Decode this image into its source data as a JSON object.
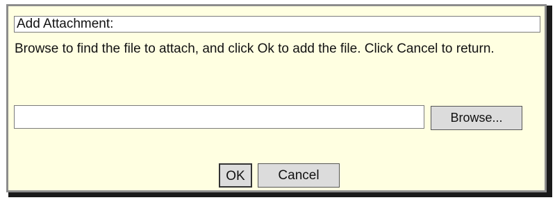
{
  "dialog": {
    "title": "Add Attachment:",
    "instructions": "Browse to find the file to attach, and click Ok to add the file. Click Cancel to return.",
    "file_input_value": "",
    "browse_label": "Browse...",
    "ok_label": "OK",
    "cancel_label": "Cancel"
  },
  "colors": {
    "dialog_background": "#ffffe1",
    "dialog_border": "#8c8c8c",
    "button_background": "#dcdcdc"
  }
}
